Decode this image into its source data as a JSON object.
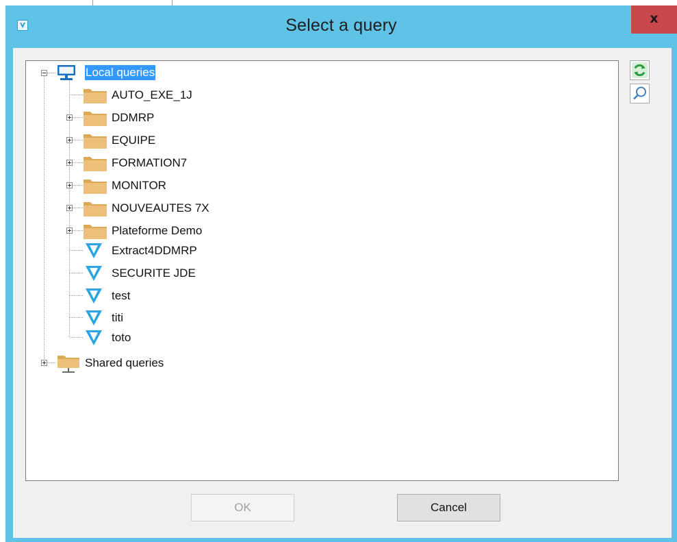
{
  "dialog": {
    "title": "Select a query",
    "close_label": "x"
  },
  "tree": {
    "root": {
      "label": "Local queries",
      "icon": "computer-icon",
      "expanded": true,
      "selected": true
    },
    "items": [
      {
        "label": "AUTO_EXE_1J",
        "icon": "folder-icon",
        "expandable": false
      },
      {
        "label": "DDMRP",
        "icon": "folder-icon",
        "expandable": true
      },
      {
        "label": "EQUIPE",
        "icon": "folder-icon",
        "expandable": true
      },
      {
        "label": "FORMATION7",
        "icon": "folder-icon",
        "expandable": true
      },
      {
        "label": "MONITOR",
        "icon": "folder-icon",
        "expandable": true
      },
      {
        "label": "NOUVEAUTES 7X",
        "icon": "folder-icon",
        "expandable": true
      },
      {
        "label": "Plateforme Demo",
        "icon": "folder-icon",
        "expandable": true
      },
      {
        "label": "Extract4DDMRP",
        "icon": "query-icon",
        "expandable": false
      },
      {
        "label": "SECURITE JDE",
        "icon": "query-icon",
        "expandable": false
      },
      {
        "label": "test",
        "icon": "query-icon",
        "expandable": false
      },
      {
        "label": "titi",
        "icon": "query-icon",
        "expandable": false
      },
      {
        "label": "toto",
        "icon": "query-icon",
        "expandable": false
      }
    ],
    "shared": {
      "label": "Shared queries",
      "icon": "network-folder-icon",
      "expanded": false
    }
  },
  "side_buttons": [
    {
      "name": "refresh-button",
      "icon": "refresh-icon"
    },
    {
      "name": "search-button",
      "icon": "search-icon"
    }
  ],
  "buttons": {
    "ok_label": "OK",
    "ok_enabled": false,
    "cancel_label": "Cancel"
  },
  "colors": {
    "title_bar": "#5fc2e6",
    "close_button": "#c8474a",
    "selection": "#3399ff",
    "folder": "#e8b96a",
    "query_icon": "#2ba6e3",
    "refresh_icon": "#2e9b3e"
  }
}
